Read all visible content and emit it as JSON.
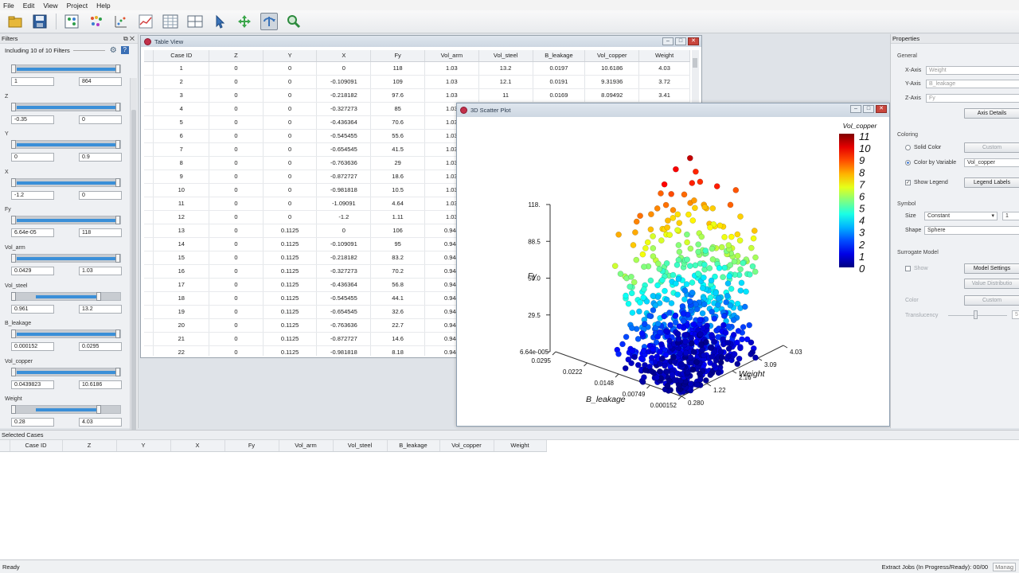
{
  "menu": [
    "File",
    "Edit",
    "View",
    "Project",
    "Help"
  ],
  "toolbar_icons": [
    "open-folder-icon",
    "save-icon",
    "table-icon",
    "scatter-matrix-icon",
    "scatter-plot-icon",
    "line-chart-icon",
    "spreadsheet-icon",
    "layout-icon",
    "pointer-icon",
    "pan-icon",
    "rotate-icon",
    "zoom-icon"
  ],
  "filters": {
    "title": "Filters",
    "including": "Including 10 of 10 Filters",
    "groups": [
      {
        "label": "",
        "min": "1",
        "max": "864"
      },
      {
        "label": "Z",
        "min": "-0.35",
        "max": "0"
      },
      {
        "label": "Y",
        "min": "0",
        "max": "0.9"
      },
      {
        "label": "X",
        "min": "-1.2",
        "max": "0"
      },
      {
        "label": "Fy",
        "min": "6.64e-05",
        "max": "118"
      },
      {
        "label": "Vol_arm",
        "min": "0.0429",
        "max": "1.03"
      },
      {
        "label": "Vol_steel",
        "min": "0.961",
        "max": "13.2"
      },
      {
        "label": "B_leakage",
        "min": "0.000152",
        "max": "0.0295"
      },
      {
        "label": "Vol_copper",
        "min": "0.0439823",
        "max": "10.6186"
      },
      {
        "label": "Weight",
        "min": "0.28",
        "max": "4.03"
      }
    ]
  },
  "table_view": {
    "title": "Table View",
    "columns": [
      "Case ID",
      "Z",
      "Y",
      "X",
      "Fy",
      "Vol_arm",
      "Vol_steel",
      "B_leakage",
      "Vol_copper",
      "Weight"
    ],
    "rows": [
      [
        "1",
        "0",
        "0",
        "0",
        "118",
        "1.03",
        "13.2",
        "0.0197",
        "10.6186",
        "4.03"
      ],
      [
        "2",
        "0",
        "0",
        "-0.109091",
        "109",
        "1.03",
        "12.1",
        "0.0191",
        "9.31936",
        "3.72"
      ],
      [
        "3",
        "0",
        "0",
        "-0.218182",
        "97.6",
        "1.03",
        "11",
        "0.0169",
        "8.09492",
        "3.41"
      ],
      [
        "4",
        "0",
        "0",
        "-0.327273",
        "85",
        "1.03",
        "",
        "",
        "",
        ""
      ],
      [
        "5",
        "0",
        "0",
        "-0.436364",
        "70.6",
        "1.03",
        "",
        "",
        "",
        ""
      ],
      [
        "6",
        "0",
        "0",
        "-0.545455",
        "55.6",
        "1.03",
        "",
        "",
        "",
        ""
      ],
      [
        "7",
        "0",
        "0",
        "-0.654545",
        "41.5",
        "1.03",
        "",
        "",
        "",
        ""
      ],
      [
        "8",
        "0",
        "0",
        "-0.763636",
        "29",
        "1.03",
        "",
        "",
        "",
        ""
      ],
      [
        "9",
        "0",
        "0",
        "-0.872727",
        "18.6",
        "1.03",
        "",
        "",
        "",
        ""
      ],
      [
        "10",
        "0",
        "0",
        "-0.981818",
        "10.5",
        "1.03",
        "",
        "",
        "",
        ""
      ],
      [
        "11",
        "0",
        "0",
        "-1.09091",
        "4.64",
        "1.03",
        "",
        "",
        "",
        ""
      ],
      [
        "12",
        "0",
        "0",
        "-1.2",
        "1.11",
        "1.03",
        "",
        "",
        "",
        ""
      ],
      [
        "13",
        "0",
        "0.1125",
        "0",
        "106",
        "0.944",
        "",
        "",
        "",
        ""
      ],
      [
        "14",
        "0",
        "0.1125",
        "-0.109091",
        "95",
        "0.944",
        "",
        "",
        "",
        ""
      ],
      [
        "15",
        "0",
        "0.1125",
        "-0.218182",
        "83.2",
        "0.944",
        "",
        "",
        "",
        ""
      ],
      [
        "16",
        "0",
        "0.1125",
        "-0.327273",
        "70.2",
        "0.944",
        "",
        "",
        "",
        ""
      ],
      [
        "17",
        "0",
        "0.1125",
        "-0.436364",
        "56.8",
        "0.944",
        "",
        "",
        "",
        ""
      ],
      [
        "18",
        "0",
        "0.1125",
        "-0.545455",
        "44.1",
        "0.944",
        "",
        "",
        "",
        ""
      ],
      [
        "19",
        "0",
        "0.1125",
        "-0.654545",
        "32.6",
        "0.944",
        "",
        "",
        "",
        ""
      ],
      [
        "20",
        "0",
        "0.1125",
        "-0.763636",
        "22.7",
        "0.944",
        "",
        "",
        "",
        ""
      ],
      [
        "21",
        "0",
        "0.1125",
        "-0.872727",
        "14.6",
        "0.944",
        "",
        "",
        "",
        ""
      ],
      [
        "22",
        "0",
        "0.1125",
        "-0.981818",
        "8.18",
        "0.944",
        "",
        "",
        "",
        ""
      ]
    ]
  },
  "scatter_window": {
    "title": "3D Scatter Plot"
  },
  "chart_data": {
    "type": "scatter",
    "title": "",
    "zlabel": "Fy",
    "xlabel": "Weight",
    "ylabel": "B_leakage",
    "z_ticks": [
      "118.",
      "88.5",
      "59.0",
      "29.5",
      "6.64e-005"
    ],
    "x_ticks": [
      "0.280",
      "1.22",
      "2.16",
      "3.09",
      "4.03"
    ],
    "y_ticks": [
      "0.000152",
      "0.00749",
      "0.0148",
      "0.0222",
      "0.0295"
    ],
    "zlim": [
      6.64e-05,
      118
    ],
    "xlim": [
      0.28,
      4.03
    ],
    "ylim": [
      0.000152,
      0.0295
    ],
    "color_variable": "Vol_copper",
    "colorbar_ticks": [
      "11",
      "10",
      "9",
      "8",
      "7",
      "6",
      "5",
      "4",
      "3",
      "2",
      "1",
      "0"
    ],
    "colorbar_range": [
      0,
      11
    ],
    "point_count_shown": 864,
    "colors": {
      "high": "#ff0000",
      "mid": "#00ff00",
      "low": "#0000ff"
    }
  },
  "properties": {
    "title": "Properties",
    "general": "General",
    "x_axis_label": "X-Axis",
    "x_axis_value": "Weight",
    "y_axis_label": "Y-Axis",
    "y_axis_value": "B_leakage",
    "z_axis_label": "Z-Axis",
    "z_axis_value": "Fy",
    "axis_details": "Axis Details",
    "coloring": "Coloring",
    "solid_color": "Solid Color",
    "custom": "Custom",
    "color_by_variable": "Color by Variable",
    "color_variable_value": "Vol_copper",
    "show_legend": "Show Legend",
    "legend_labels": "Legend Labels",
    "symbol": "Symbol",
    "size_label": "Size",
    "size_value": "Constant",
    "size_num": "1",
    "shape_label": "Shape",
    "shape_value": "Sphere",
    "surrogate_model": "Surrogate Model",
    "show": "Show",
    "model_settings": "Model Settings",
    "value_distribution": "Value Distributio",
    "color": "Color",
    "custom2": "Custom",
    "translucency": "Translucency",
    "translucency_value": "5"
  },
  "selected_cases": {
    "title": "Selected Cases",
    "columns": [
      "Case ID",
      "Z",
      "Y",
      "X",
      "Fy",
      "Vol_arm",
      "Vol_steel",
      "B_leakage",
      "Vol_copper",
      "Weight"
    ]
  },
  "status": {
    "left": "Ready",
    "right": "Extract Jobs (In Progress/Ready): 00/00",
    "manage": "Manag"
  }
}
